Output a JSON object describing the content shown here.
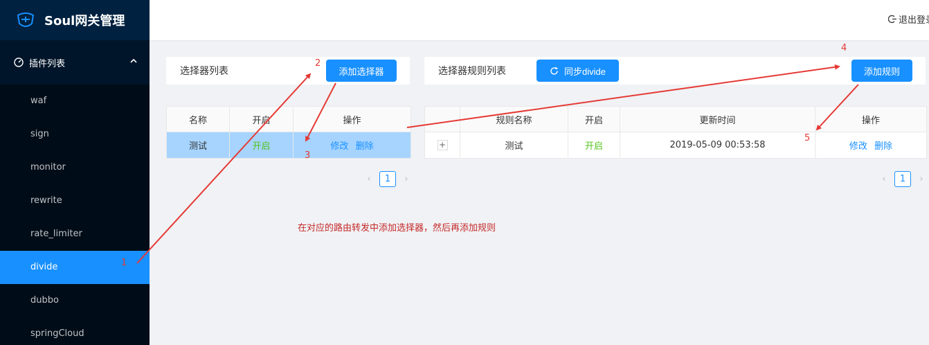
{
  "app": {
    "title": "Soul网关管理"
  },
  "header": {
    "logout_label": "退出登录"
  },
  "sidebar": {
    "group_label": "插件列表",
    "items": [
      {
        "label": "waf"
      },
      {
        "label": "sign"
      },
      {
        "label": "monitor"
      },
      {
        "label": "rewrite"
      },
      {
        "label": "rate_limiter"
      },
      {
        "label": "divide",
        "active": true
      },
      {
        "label": "dubbo"
      },
      {
        "label": "springCloud"
      }
    ]
  },
  "selector_panel": {
    "title": "选择器列表",
    "add_button": "添加选择器",
    "columns": [
      "名称",
      "开启",
      "操作"
    ],
    "rows": [
      {
        "name": "测试",
        "enabled": "开启",
        "edit": "修改",
        "delete": "删除"
      }
    ],
    "page": "1"
  },
  "rule_panel": {
    "title": "选择器规则列表",
    "sync_button": "同步divide",
    "add_button": "添加规则",
    "columns": [
      "",
      "规则名称",
      "开启",
      "更新时间",
      "操作"
    ],
    "rows": [
      {
        "expand": "+",
        "name": "测试",
        "enabled": "开启",
        "updated": "2019-05-09 00:53:58",
        "edit": "修改",
        "delete": "删除"
      }
    ],
    "page": "1"
  },
  "annotation": {
    "note": "在对应的路由转发中添加选择器，然后再添加规则",
    "markers": [
      "1",
      "2",
      "3",
      "4",
      "5"
    ]
  },
  "colors": {
    "accent": "#1890ff",
    "sidebar": "#001529",
    "enabled": "#52c41a",
    "annotation": "#e53935"
  }
}
